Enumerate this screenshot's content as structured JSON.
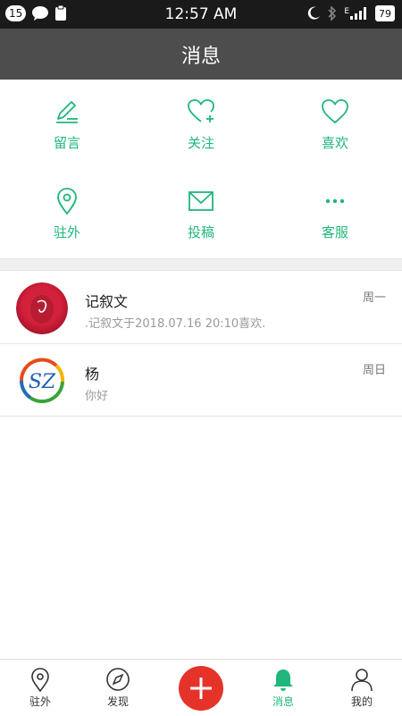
{
  "status_bar": {
    "notification_count": "15",
    "time": "12:57 AM",
    "network": "E",
    "battery": "79"
  },
  "header": {
    "title": "消息"
  },
  "actions": [
    {
      "label": "留言",
      "icon": "pen-icon"
    },
    {
      "label": "关注",
      "icon": "heart-plus-icon"
    },
    {
      "label": "喜欢",
      "icon": "heart-icon"
    },
    {
      "label": "驻外",
      "icon": "location-pin-icon"
    },
    {
      "label": "投稿",
      "icon": "envelope-icon"
    },
    {
      "label": "客服",
      "icon": "more-dots-icon"
    }
  ],
  "messages": [
    {
      "name": "记叙文",
      "preview": ".记叙文于2018.07.16 20:10喜欢.",
      "day": "周一"
    },
    {
      "name": "杨",
      "preview": "你好",
      "day": "周日",
      "avatar_text": "SZ"
    }
  ],
  "bottom_nav": [
    {
      "label": "驻外",
      "icon": "location-pin-icon"
    },
    {
      "label": "发现",
      "icon": "compass-icon"
    },
    {
      "label": "",
      "icon": "plus-icon"
    },
    {
      "label": "消息",
      "icon": "bell-icon",
      "active": true
    },
    {
      "label": "我的",
      "icon": "person-icon"
    }
  ],
  "colors": {
    "accent": "#1fb77a",
    "header": "#4d4d4d",
    "publish": "#e5332a"
  }
}
